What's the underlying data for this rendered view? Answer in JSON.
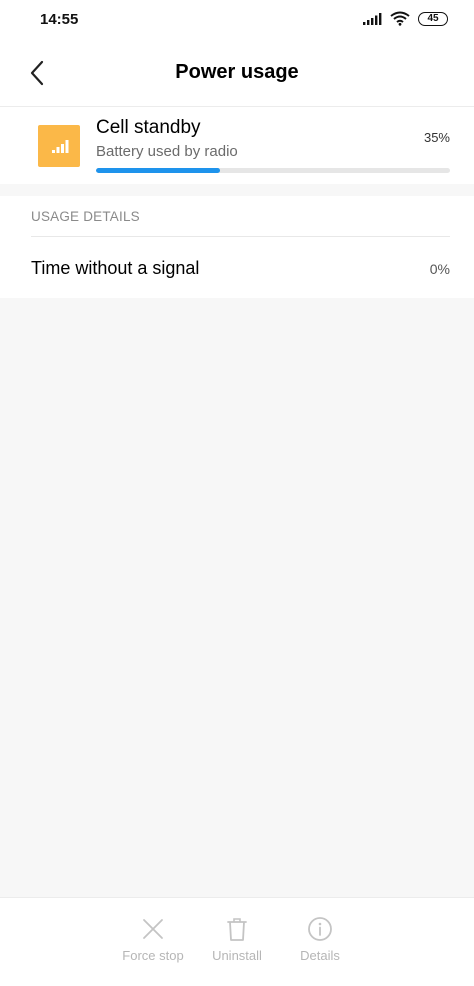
{
  "status_bar": {
    "time": "14:55",
    "battery_level": "45",
    "icons": [
      "signal-icon",
      "wifi-icon",
      "battery-icon"
    ]
  },
  "header": {
    "title": "Power usage",
    "back_icon": "back-arrow-icon"
  },
  "app": {
    "name": "Cell standby",
    "subtitle": "Battery used by radio",
    "percent": "35%",
    "usage_fraction": 0.35,
    "icon": "cell-signal-icon",
    "icon_color": "#fbb848",
    "bar_color": "#1e93ec"
  },
  "usage_details": {
    "header": "USAGE DETAILS",
    "rows": [
      {
        "label": "Time without a signal",
        "value": "0%"
      }
    ]
  },
  "bottom_actions": [
    {
      "label": "Force stop",
      "icon": "close-icon",
      "enabled": false
    },
    {
      "label": "Uninstall",
      "icon": "trash-icon",
      "enabled": false
    },
    {
      "label": "Details",
      "icon": "info-icon",
      "enabled": false
    }
  ]
}
